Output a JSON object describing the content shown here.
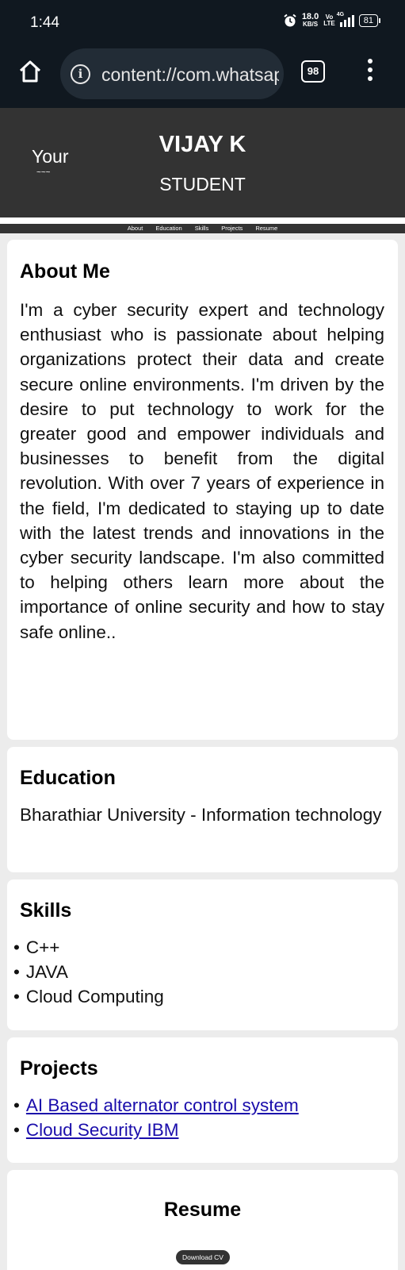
{
  "status_bar": {
    "time": "1:44",
    "speed_value": "18.0",
    "speed_unit": "KB/S",
    "volte_top": "Vo",
    "volte_bottom": "LTE",
    "network": "4G",
    "battery": "81"
  },
  "browser": {
    "url": "content://com.whatsapp",
    "tab_count": "98"
  },
  "header": {
    "profile_alt": "Your",
    "name": "VIJAY K",
    "role": "STUDENT"
  },
  "nav": {
    "items": [
      "About",
      "Education",
      "Skills",
      "Projects",
      "Resume"
    ]
  },
  "about": {
    "title": "About Me",
    "text": "I'm a cyber security expert and technology enthusiast who is passionate about helping organizations protect their data and create secure online environments. I'm driven by the desire to put technology to work for the greater good and empower individuals and businesses to benefit from the digital revolution. With over 7 years of experience in the field, I'm dedicated to staying up to date with the latest trends and innovations in the cyber security landscape. I'm also committed to helping others learn more about the importance of online security and how to stay safe online.."
  },
  "education": {
    "title": "Education",
    "text": "Bharathiar University - Information technology"
  },
  "skills": {
    "title": "Skills",
    "items": [
      "C++",
      "JAVA",
      "Cloud Computing"
    ]
  },
  "projects": {
    "title": "Projects",
    "items": [
      "AI Based alternator control system",
      "Cloud Security IBM"
    ]
  },
  "resume": {
    "title": "Resume",
    "button_label": "Download CV"
  },
  "colors": {
    "status_bar_bg": "#101820",
    "header_bg": "#333333",
    "page_bg": "#ececec",
    "link": "#1a0dab"
  }
}
